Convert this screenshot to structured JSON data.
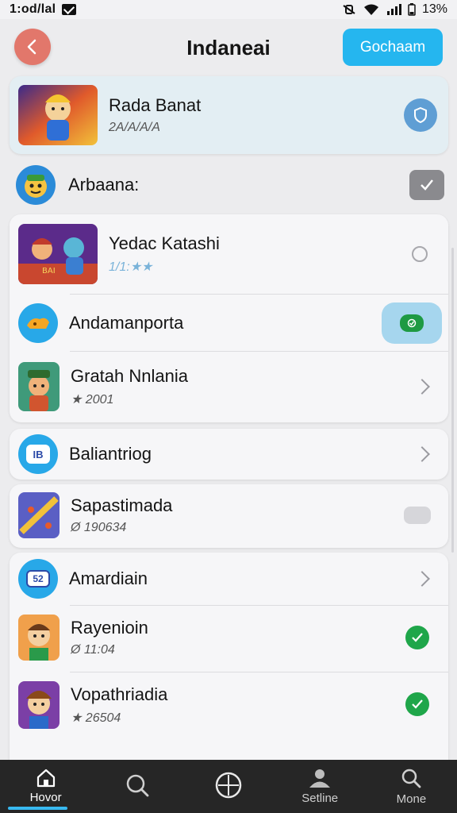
{
  "status_bar": {
    "time": "1:od/lal",
    "battery": "13%"
  },
  "header": {
    "title": "Indaneai",
    "action_label": "Gochaam",
    "back_icon": "chevron-left-icon"
  },
  "featured": {
    "title": "Rada Banat",
    "subtitle": "2A/A/A/A",
    "action_icon": "shield-icon"
  },
  "section": {
    "title": "Arbaana:",
    "toggle_icon": "check-icon"
  },
  "group1": [
    {
      "title": "Yedac Katashi",
      "subtitle": "1/1:★★",
      "trailing": "radio"
    },
    {
      "title": "Andamanporta",
      "subtitle": "",
      "trailing": "toggle-on"
    },
    {
      "title": "Gratah Nnlania",
      "subtitle": "★ 2001",
      "trailing": "chevron"
    }
  ],
  "group2": [
    {
      "title": "Baliantriog",
      "subtitle": "",
      "trailing": "chevron"
    }
  ],
  "group3": [
    {
      "title": "Sapastimada",
      "subtitle": "Ø 190634",
      "trailing": "toggle-off"
    }
  ],
  "group4": [
    {
      "title": "Amardiain",
      "subtitle": "",
      "trailing": "chevron",
      "badge": "52"
    },
    {
      "title": "Rayenioin",
      "subtitle": "Ø 11:04",
      "trailing": "check"
    },
    {
      "title": "Vopathriadia",
      "subtitle": "★ 26504",
      "trailing": "check"
    }
  ],
  "bottom_nav": [
    {
      "label": "Hovor",
      "icon": "home-icon"
    },
    {
      "label": "",
      "icon": "search-icon"
    },
    {
      "label": "",
      "icon": "compass-icon"
    },
    {
      "label": "Setline",
      "icon": "profile-icon"
    },
    {
      "label": "Mone",
      "icon": "search-icon"
    }
  ],
  "colors": {
    "accent": "#25b6ef",
    "back": "#e2776b",
    "success": "#1fa64a",
    "nav_bg": "#262626"
  }
}
